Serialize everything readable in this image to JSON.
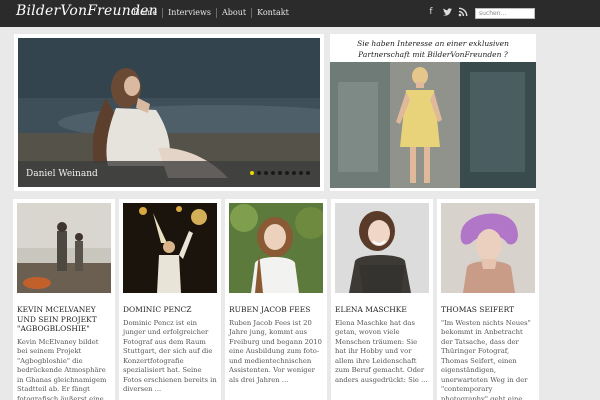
{
  "header": {
    "logo": "BilderVonFreunden",
    "nav": [
      {
        "label": "Home"
      },
      {
        "label": "Interviews"
      },
      {
        "label": "About"
      },
      {
        "label": "Kontakt"
      }
    ],
    "social_icons": [
      "facebook-icon",
      "twitter-icon",
      "rss-icon"
    ],
    "search_placeholder": "suchen..."
  },
  "slider": {
    "caption": "Daniel Weinand",
    "dot_count": 9,
    "active_dot": 0
  },
  "promo": {
    "text": "Sie haben Interesse an einer exklusiven Partnerschaft mit BilderVonFreunden ?"
  },
  "articles": [
    {
      "title": "KEVIN MCELVANEY UND SEIN PROJEKT \"AGBOGBLOSHIE\"",
      "excerpt": "Kevin McElvaney bildet bei seinem Projekt \"Agbogbloshie\" die bedrückende Atmosphäre in Ghanas gleichnamigem Stadtteil ab. Er fängt fotografisch äußerst eine ..."
    },
    {
      "title": "DOMINIC PENCZ",
      "excerpt": "Dominic Pencz ist ein junger und erfolgreicher Fotograf aus dem Raum Stuttgart, der sich auf die Konzertfotografie spezialisiert hat. Seine Fotos erschienen bereits in diversen ..."
    },
    {
      "title": "RUBEN JACOB FEES",
      "excerpt": "Ruben Jacob Fees ist 20 Jahre jung, kommt aus Freiburg und begann 2010 eine Ausbildung zum foto- und medientechnischen Assistenten. Vor weniger als drei Jahren ..."
    },
    {
      "title": "ELENA MASCHKE",
      "excerpt": "Elena Maschke hat das getan, wovon viele Menschen träumen: Sie hat ihr Hobby und vor allem ihre Leidenschaft zum Beruf gemacht. Oder anders ausgedrückt: Sie ..."
    },
    {
      "title": "THOMAS SEIFERT",
      "excerpt": "\"Im Westen nichts Neues\" bekommt in Anbetracht der Tatsache, dass der Thüringer Fotograf, Thomas Seifert, einen eigenständigen, unerwarteten Weg in der \"contemporary photography\" geht eine ..."
    }
  ]
}
